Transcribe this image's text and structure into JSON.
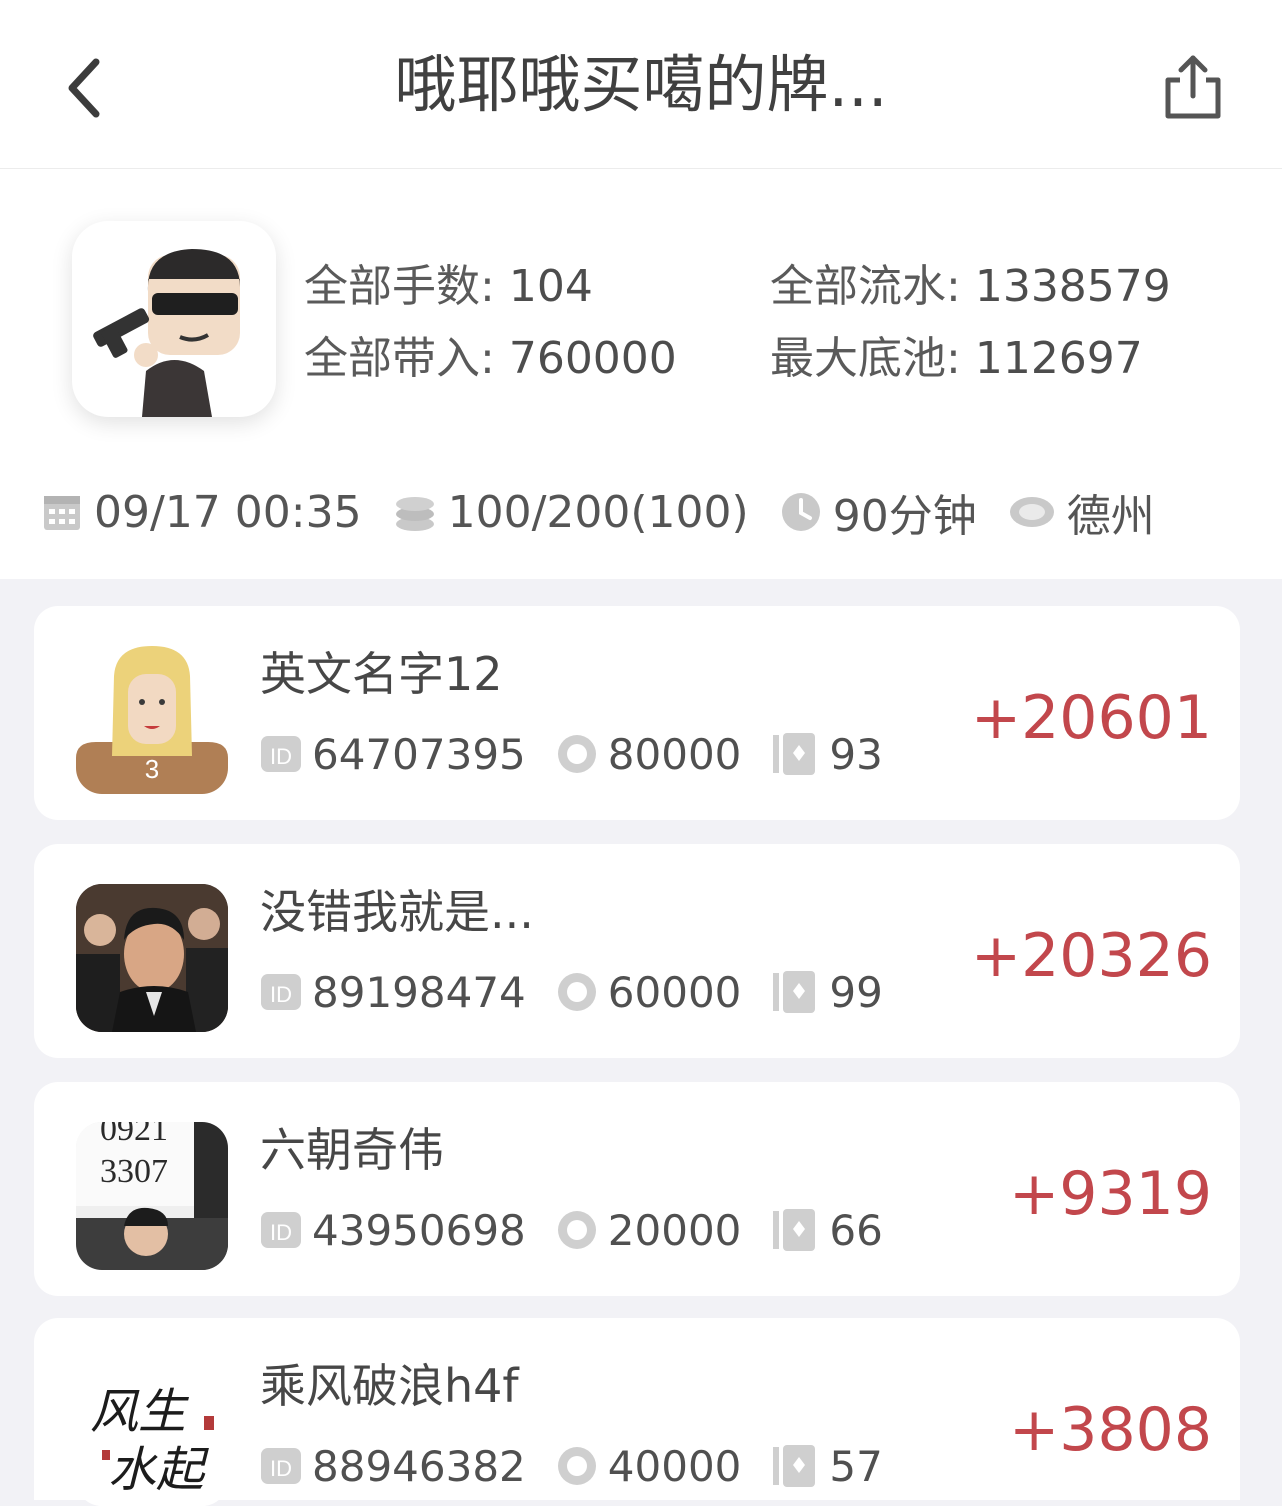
{
  "header": {
    "title": "哦耶哦买噶的牌...",
    "back_icon": "chevron-left-icon",
    "share_icon": "share-icon"
  },
  "summary": {
    "stats": {
      "total_hands_label": "全部手数:",
      "total_hands": "104",
      "total_flow_label": "全部流水:",
      "total_flow": "1338579",
      "total_buyin_label": "全部带入:",
      "total_buyin": "760000",
      "max_pot_label": "最大底池:",
      "max_pot": "112697"
    },
    "meta": {
      "datetime": "09/17 00:35",
      "blinds": "100/200(100)",
      "duration": "90分钟",
      "game_type": "德州"
    }
  },
  "players": [
    {
      "name": "英文名字12",
      "id": "64707395",
      "buyin": "80000",
      "hands": "93",
      "score": "+20601",
      "badge": "3"
    },
    {
      "name": "没错我就是...",
      "id": "89198474",
      "buyin": "60000",
      "hands": "99",
      "score": "+20326"
    },
    {
      "name": "六朝奇伟",
      "id": "43950698",
      "buyin": "20000",
      "hands": "66",
      "score": "+9319",
      "avatar_text": [
        "0921",
        "3307"
      ]
    },
    {
      "name": "乘风破浪h4f",
      "id": "88946382",
      "buyin": "40000",
      "hands": "57",
      "score": "+3808",
      "avatar_text": [
        "风生",
        "水起"
      ]
    }
  ],
  "colors": {
    "score": "#c2474c",
    "icon_gray": "#c9c9c9",
    "background": "#f2f2f6"
  }
}
